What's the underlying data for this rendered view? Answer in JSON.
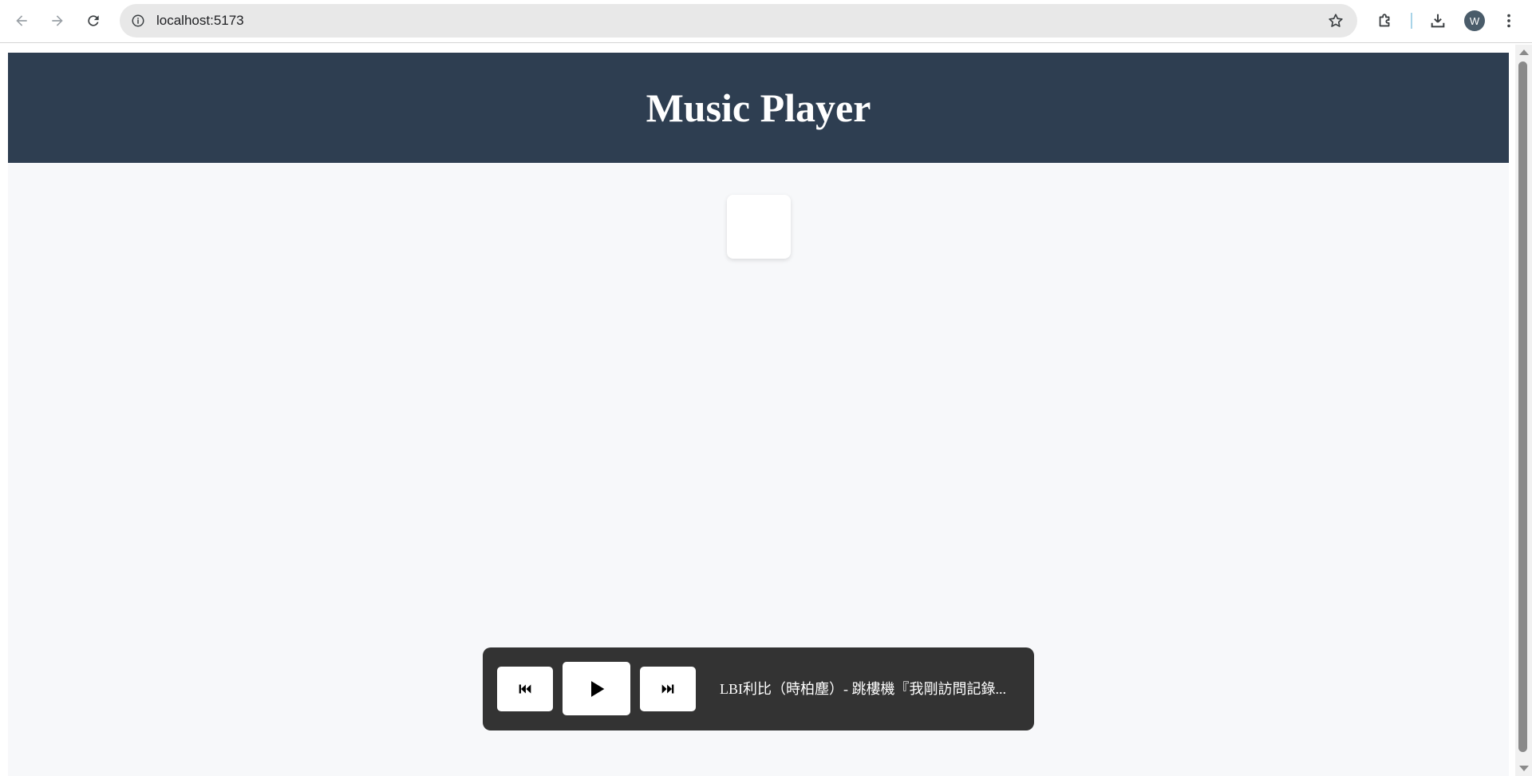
{
  "browser": {
    "url": "localhost:5173",
    "profile_initial": "W",
    "icons": {
      "back": "arrow-left-icon",
      "forward": "arrow-right-icon",
      "reload": "reload-icon",
      "site_info": "info-icon",
      "bookmark": "star-icon",
      "extensions": "puzzle-icon",
      "downloads": "download-icon",
      "menu": "kebab-menu-icon"
    }
  },
  "app": {
    "title": "Music Player",
    "colors": {
      "header_bg": "#2e3e51",
      "page_bg": "#f7f8fa",
      "player_bg": "#333333"
    }
  },
  "player": {
    "prev_symbol": "⏮",
    "play_symbol": "▶",
    "next_symbol": "⏭",
    "track_title": "LBI利比（時柏塵）- 跳樓機『我剛訪問記錄..."
  }
}
